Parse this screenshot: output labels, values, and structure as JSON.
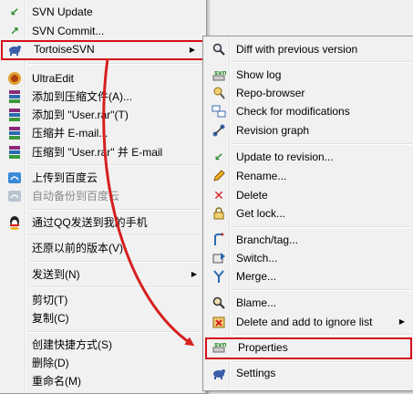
{
  "left_menu": {
    "svn_update": "SVN Update",
    "svn_commit": "SVN Commit...",
    "tortoise": "TortoiseSVN",
    "ultraedit": "UltraEdit",
    "add_archive": "添加到压缩文件(A)...",
    "add_rar": "添加到 \"User.rar\"(T)",
    "compress_email": "压缩并 E-mail...",
    "compress_rar_email": "压缩到 \"User.rar\" 并 E-mail",
    "upload_baidu": "上传到百度云",
    "auto_backup_baidu": "自动备份到百度云",
    "qq_send": "通过QQ发送到我的手机",
    "restore_version": "还原以前的版本(V)",
    "send_to": "发送到(N)",
    "cut": "剪切(T)",
    "copy": "复制(C)",
    "create_shortcut": "创建快捷方式(S)",
    "delete": "删除(D)",
    "rename": "重命名(M)"
  },
  "right_menu": {
    "diff": "Diff with previous version",
    "show_log": "Show log",
    "repo_browser": "Repo-browser",
    "check_mod": "Check for modifications",
    "rev_graph": "Revision graph",
    "update_rev": "Update to revision...",
    "rename": "Rename...",
    "delete": "Delete",
    "get_lock": "Get lock...",
    "branch_tag": "Branch/tag...",
    "switch": "Switch...",
    "merge": "Merge...",
    "blame": "Blame...",
    "delete_ignore": "Delete and add to ignore list",
    "properties": "Properties",
    "settings": "Settings"
  },
  "colors": {
    "highlight_border": "#d6101a",
    "menu_bg": "#f1f1f1"
  }
}
